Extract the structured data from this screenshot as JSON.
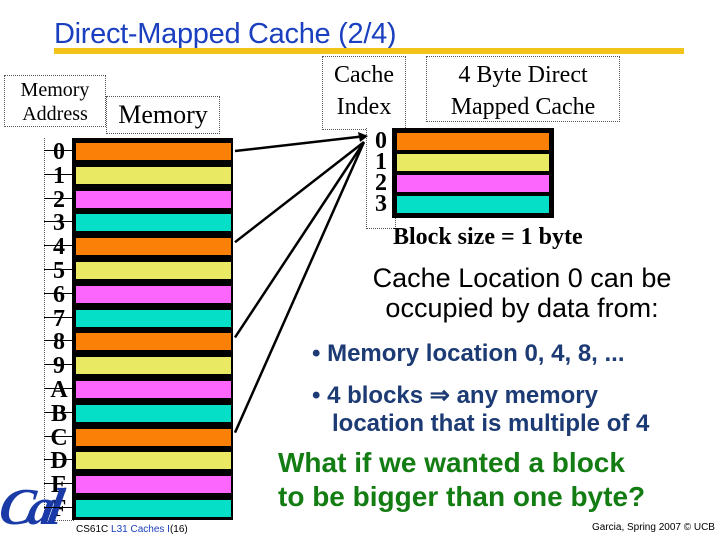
{
  "slide": {
    "title": "Direct-Mapped Cache (2/4)",
    "colors": {
      "title": "#1a3fbf",
      "title_underline": "#f2c318",
      "orange": "#fb8008",
      "yellow": "#e9e964",
      "magenta": "#fd66fc",
      "cyan": "#06dfc8",
      "bullet_text": "#1c3a73",
      "question_text": "#137d13"
    }
  },
  "memory": {
    "address_label_line1": "Memory",
    "address_label_line2": "Address",
    "label": "Memory",
    "addresses": [
      "0",
      "1",
      "2",
      "3",
      "4",
      "5",
      "6",
      "7",
      "8",
      "9",
      "A",
      "B",
      "C",
      "D",
      "E",
      "F"
    ],
    "row_colors": [
      "orange",
      "yellow",
      "magenta",
      "cyan",
      "orange",
      "yellow",
      "magenta",
      "cyan",
      "orange",
      "yellow",
      "magenta",
      "cyan",
      "orange",
      "yellow",
      "magenta",
      "cyan"
    ]
  },
  "cache": {
    "index_label_line1": "Cache",
    "index_label_line2": "Index",
    "title_line1": "4  Byte Direct",
    "title_line2": "Mapped Cache",
    "indices": [
      "0",
      "1",
      "2",
      "3"
    ],
    "row_colors": [
      "orange",
      "yellow",
      "magenta",
      "cyan"
    ],
    "block_size": "Block size = 1 byte"
  },
  "mapping": {
    "from_memory_addresses": [
      "0",
      "4",
      "8",
      "C"
    ],
    "to_cache_index": "0"
  },
  "text": {
    "location_heading_line1": "Cache Location 0 can be",
    "location_heading_line2": "occupied by data from:",
    "bullets": [
      {
        "line1": "Memory location 0, 4, 8, ..."
      },
      {
        "line1": "4 blocks ⇒ any memory",
        "line2": "location that is multiple of 4"
      }
    ],
    "question_line1": "What if we wanted a block",
    "question_line2": "to be bigger than one byte?"
  },
  "footer": {
    "course": "CS61C",
    "lecture": "L31 Caches I",
    "page": "(16)",
    "credit": "Garcia, Spring 2007 © UCB",
    "logo_text": "Cal"
  }
}
